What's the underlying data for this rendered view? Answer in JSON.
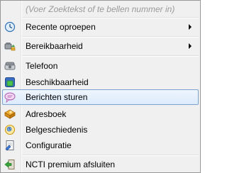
{
  "search": {
    "placeholder": "(Voer Zoektekst of te bellen nummer in)"
  },
  "menu": {
    "recent": {
      "label": "Recente oproepen",
      "icon": "clock-icon"
    },
    "availability": {
      "label": "Bereikbaarheid",
      "icon": "phone-forward-icon"
    },
    "phone": {
      "label": "Telefoon",
      "icon": "telephone-icon"
    },
    "presence": {
      "label": "Beschikbaarheid",
      "icon": "presence-icon"
    },
    "messages": {
      "label": "Berichten sturen",
      "icon": "chat-bubble-icon"
    },
    "addressbook": {
      "label": "Adresboek",
      "icon": "address-book-icon"
    },
    "history": {
      "label": "Belgeschiedenis",
      "icon": "call-history-icon"
    },
    "config": {
      "label": "Configuratie",
      "icon": "configuration-icon"
    },
    "exit": {
      "label": "NCTI premium afsluiten",
      "icon": "exit-icon"
    }
  },
  "colors": {
    "hover_border": "#7da2ce",
    "hover_fill": "#dcebfc",
    "menu_bg": "#f0f0f0",
    "placeholder_text": "#9a9a9a"
  }
}
